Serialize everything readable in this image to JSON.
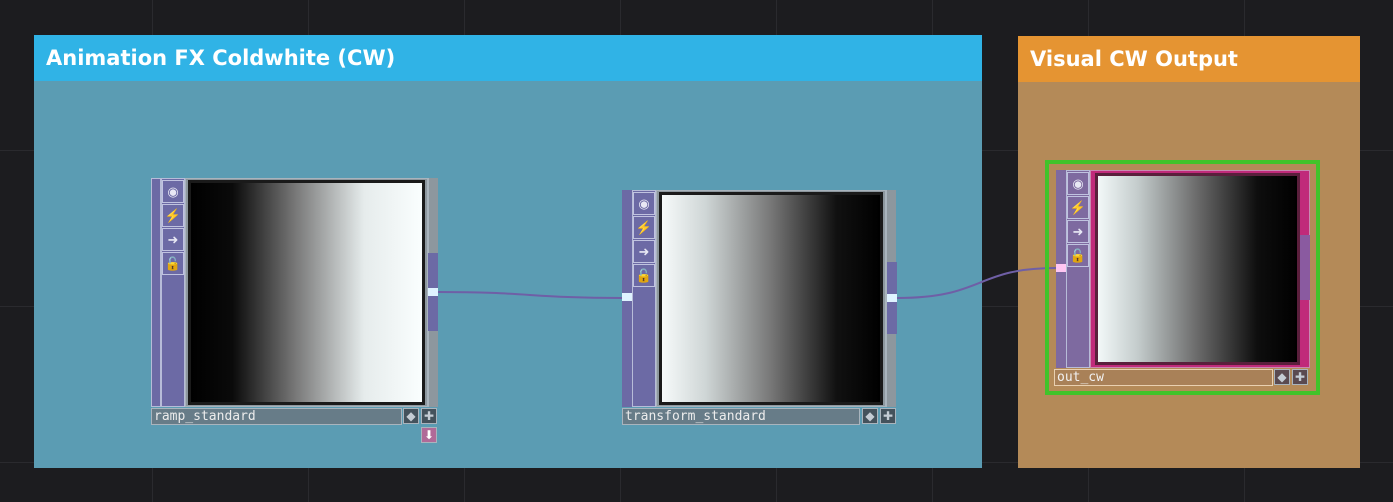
{
  "annotations": {
    "animation_group": {
      "title": "Animation FX Coldwhite (CW)",
      "color": "#30b3e6"
    },
    "output_group": {
      "title": "Visual CW Output",
      "color": "#e59432"
    }
  },
  "nodes": {
    "ramp": {
      "name": "ramp_standard",
      "gradient": "black-to-white"
    },
    "transform": {
      "name": "transform_standard",
      "gradient": "white-to-black"
    },
    "out": {
      "name": "out_cw",
      "gradient": "white-to-black",
      "selected": true
    }
  },
  "flag_icons": [
    "viewer-icon",
    "cook-icon",
    "bypass-icon",
    "lock-icon"
  ],
  "colors": {
    "wire": "#6f5fa6",
    "selection": "#41c32a",
    "output_tint": "#c02a7a"
  }
}
